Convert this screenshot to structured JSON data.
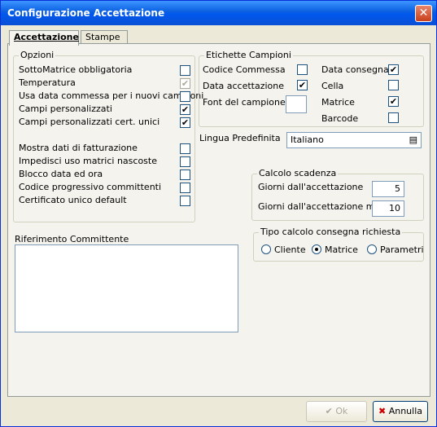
{
  "window": {
    "title": "Configurazione Accettazione",
    "close_icon": "✕"
  },
  "tabs": [
    {
      "label": "Accettazione",
      "active": true
    },
    {
      "label": "Stampe",
      "active": false
    }
  ],
  "opzioni": {
    "legend": "Opzioni",
    "items": [
      {
        "label": "SottoMatrice obbligatoria",
        "checked": false
      },
      {
        "label": "Temperatura",
        "checked": true,
        "disabled": true
      },
      {
        "label": "Usa data commessa per i nuovi campioni",
        "checked": false
      },
      {
        "label": "Campi personalizzati",
        "checked": true
      },
      {
        "label": "Campi personalizzati cert. unici",
        "checked": true
      },
      {
        "label": "Mostra dati di fatturazione",
        "checked": false
      },
      {
        "label": "Impedisci uso matrici nascoste",
        "checked": false
      },
      {
        "label": "Blocco data ed ora",
        "checked": false
      },
      {
        "label": "Codice progressivo committenti",
        "checked": false
      },
      {
        "label": "Certificato unico default",
        "checked": false
      }
    ]
  },
  "etichette": {
    "legend": "Etichette Campioni",
    "codice_commessa": "Codice Commessa",
    "data_accettazione": "Data accettazione",
    "font_campione": "Font del campione",
    "data_consegna": "Data consegna",
    "cella": "Cella",
    "matrice": "Matrice",
    "barcode": "Barcode",
    "check": "✔"
  },
  "lingua": {
    "label": "Lingua Predefinita",
    "value": "Italiano",
    "icon": "▤"
  },
  "scadenza": {
    "legend": "Calcolo scadenza",
    "giorni_label": "Giorni dall'accettazione",
    "giorni_value": "5",
    "giorni_max_label": "Giorni dall'accettazione max",
    "giorni_max_value": "10"
  },
  "consegna": {
    "legend": "Tipo calcolo consegna richiesta",
    "options": [
      "Cliente",
      "Matrice",
      "Parametri"
    ],
    "selected": "Matrice"
  },
  "riferimento": {
    "legend": "Riferimento Committente",
    "value": ""
  },
  "buttons": {
    "ok": "Ok",
    "ok_icon": "✔",
    "annulla": "Annulla",
    "annulla_icon": "✖"
  }
}
